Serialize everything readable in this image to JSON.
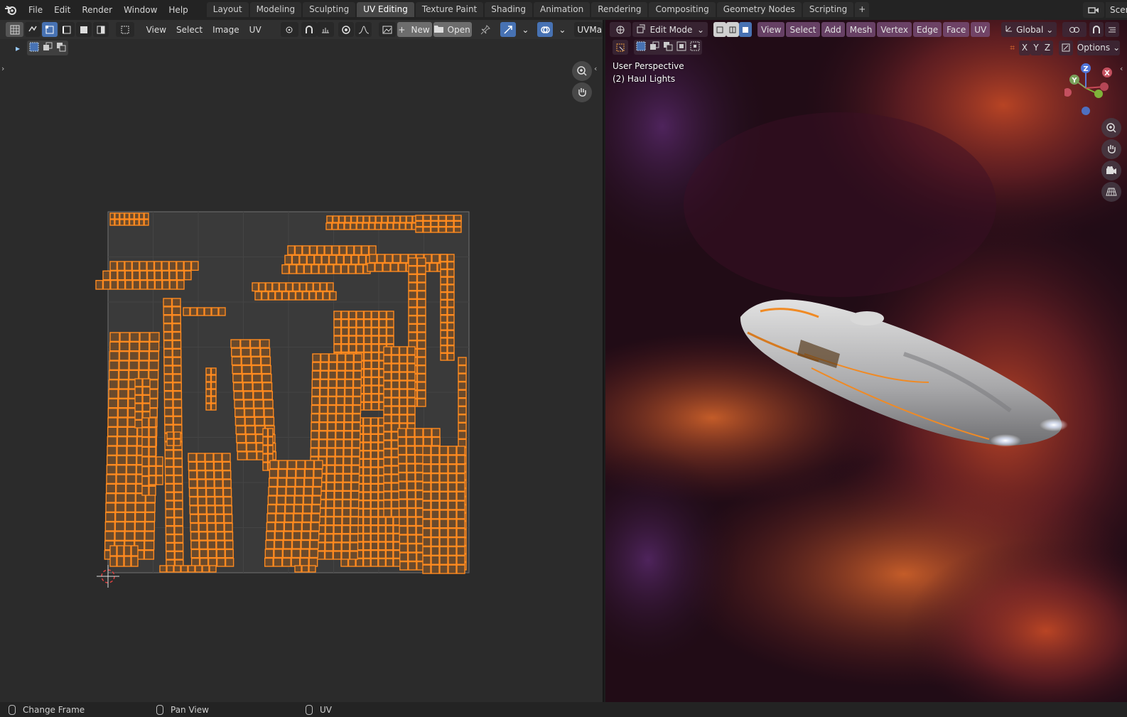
{
  "app": {
    "menu": [
      "File",
      "Edit",
      "Render",
      "Window",
      "Help"
    ],
    "workspaces": [
      "Layout",
      "Modeling",
      "Sculpting",
      "UV Editing",
      "Texture Paint",
      "Shading",
      "Animation",
      "Rendering",
      "Compositing",
      "Geometry Nodes",
      "Scripting"
    ],
    "active_workspace": "UV Editing",
    "add_tab": "+",
    "scene_label": "Scen"
  },
  "uv_editor": {
    "menus": [
      "View",
      "Select",
      "Image",
      "UV"
    ],
    "new_label": "New",
    "open_label": "Open",
    "uvmap_label": "UVMap",
    "grid_bg": "#3a3a3a",
    "island_color": "#ff8a1f"
  },
  "viewport": {
    "mode_label": "Edit Mode",
    "menus": [
      "View",
      "Select",
      "Add",
      "Mesh",
      "Vertex",
      "Edge",
      "Face",
      "UV"
    ],
    "orientation_label": "Global",
    "axis_x": "X",
    "axis_y": "Y",
    "axis_z": "Z",
    "options_label": "Options",
    "view_name": "User Perspective",
    "object_name": "(2) Haul Lights",
    "gizmo": {
      "z": "Z",
      "y": "Y",
      "x": "X"
    }
  },
  "status": {
    "left_label": "Change Frame",
    "middle_label": "Pan View",
    "right_label": "UV"
  }
}
